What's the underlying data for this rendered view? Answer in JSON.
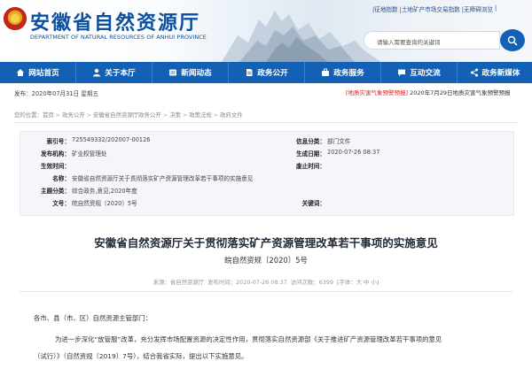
{
  "header": {
    "title": "安徽省自然资源厅",
    "subtitle": "DEPARTMENT OF NATURAL RESOURCES OF ANHUI PROVINCE",
    "top_links": [
      "|征地指数",
      "|土地矿产市场交易指数",
      "|无障碍浏览",
      "|"
    ],
    "search_placeholder": "请输入需要查询的关键词"
  },
  "nav": [
    {
      "label": "网站首页",
      "icon": "home-icon"
    },
    {
      "label": "关于本厅",
      "icon": "user-icon"
    },
    {
      "label": "新闻动态",
      "icon": "news-icon"
    },
    {
      "label": "政务公开",
      "icon": "document-icon"
    },
    {
      "label": "政务服务",
      "icon": "service-icon"
    },
    {
      "label": "互动交流",
      "icon": "chat-icon"
    },
    {
      "label": "政务新媒体",
      "icon": "share-icon"
    }
  ],
  "date_bar": {
    "date": "发布：2020年07月31日 星期五",
    "alert_tag": "[地质灾害气象预警预报]",
    "alert_text": "2020年7月29日地质灾害气象预警预报"
  },
  "breadcrumb": [
    "您的位置：首页",
    "政务公开",
    "安徽省自然资源厅政务公开",
    "决策",
    "政策法规",
    "政府文件"
  ],
  "info": {
    "index_label": "索引号：",
    "index_value": "725549332/202007-00126",
    "info_class_label": "信息分类：",
    "info_class_value": "部门文件",
    "org_label": "发布机构：",
    "org_value": "矿业权管理处",
    "gen_date_label": "生成日期：",
    "gen_date_value": "2020-07-26 08:37",
    "effective_label": "生效时间：",
    "effective_value": "",
    "repeal_label": "废止时间：",
    "repeal_value": "",
    "name_label": "名称：",
    "name_value": "安徽省自然资源厅关于贯彻落实矿产资源管理改革若干事项的实施意见",
    "topic_label": "主题分类：",
    "topic_value": "综合政务,意见,2020年度",
    "docno_label": "文号：",
    "docno_value": "皖自然资规〔2020〕5号",
    "keywords_label": "关键词：",
    "keywords_value": ""
  },
  "article": {
    "title": "安徽省自然资源厅关于贯彻落实矿产资源管理改革若干事项的实施意见",
    "doc_no": "皖自然资规〔2020〕5号",
    "meta_source": "来源：省自然资源厅",
    "meta_date": "发布时间：2020-07-26 08:37",
    "meta_views": "访问次数：6399",
    "meta_font": "[字体：大 中 小]",
    "salutation": "各市、县（市、区）自然资源主管部门：",
    "paragraph_1a": "为进一步深化“放管服”改革，充分发挥市场配置资源的决定性作用，贯彻落实自然资源部《关于推进矿产资源管理改革若干事项的意见",
    "paragraph_1b": "（试行）》（自然资规〔2019〕7号），结合我省实际，提出以下实施意见。"
  },
  "colors": {
    "brand_blue": "#1460b4",
    "title_blue": "#0c4f9e",
    "alert_red": "#d42020"
  }
}
